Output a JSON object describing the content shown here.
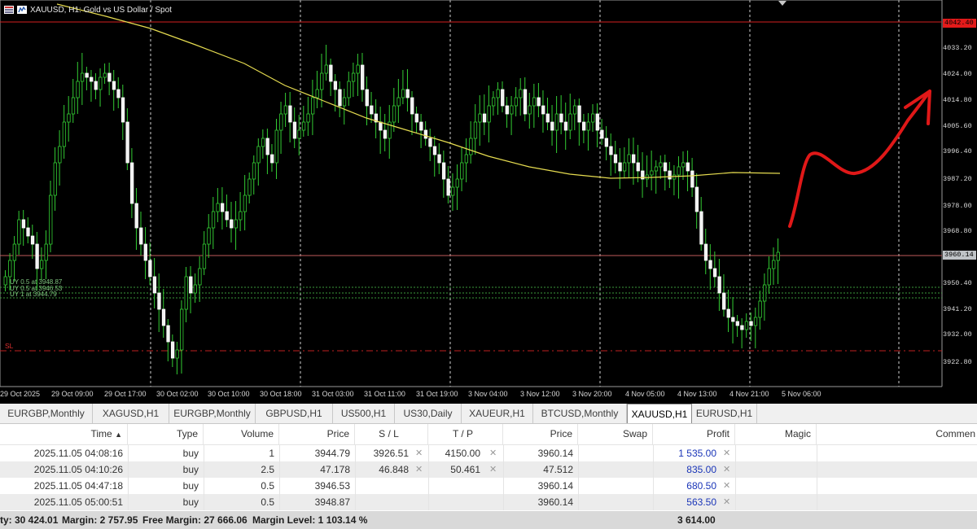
{
  "chart": {
    "title": "XAUUSD, H1:  Gold vs US Dollar / Spot",
    "price_scale": [
      "4033.20",
      "4024.00",
      "4014.80",
      "4005.60",
      "3996.40",
      "3987.20",
      "3978.00",
      "3968.80",
      "3950.40",
      "3941.20",
      "3932.00",
      "3922.80"
    ],
    "tags": {
      "top_red": "4042.40",
      "current_price": "3960.14"
    },
    "time_labels": [
      "29 Oct 2025",
      "29 Oct 09:00",
      "29 Oct 17:00",
      "30 Oct 02:00",
      "30 Oct 10:00",
      "30 Oct 18:00",
      "31 Oct 03:00",
      "31 Oct 11:00",
      "31 Oct 19:00",
      "3 Nov 04:00",
      "3 Nov 12:00",
      "3 Nov 20:00",
      "4 Nov 05:00",
      "4 Nov 13:00",
      "4 Nov 21:00",
      "5 Nov 06:00"
    ],
    "order_lines": [
      "UY 0.5 at 3948.87",
      "UY 0.5 at 3946.53",
      "UY 1 at 3944.79"
    ],
    "sl_label": "SL",
    "colors": {
      "candle": "#33cc33",
      "ma": "#e6dc50",
      "annotation": "#e01818",
      "price_line": "#c05a5a"
    }
  },
  "tabs": [
    "EURGBP,Monthly",
    "XAGUSD,H1",
    "EURGBP,Monthly",
    "GBPUSD,H1",
    "US500,H1",
    "US30,Daily",
    "XAUEUR,H1",
    "BTCUSD,Monthly",
    "XAUUSD,H1",
    "EURUSD,H1"
  ],
  "active_tab": "XAUUSD,H1",
  "table": {
    "headers": {
      "time": "Time",
      "type": "Type",
      "volume": "Volume",
      "price": "Price",
      "sl": "S / L",
      "tp": "T / P",
      "price2": "Price",
      "swap": "Swap",
      "profit": "Profit",
      "magic": "Magic",
      "comment": "Commen"
    },
    "sort_arrow": "▲",
    "rows": [
      {
        "time": "2025.11.05 04:08:16",
        "type": "buy",
        "volume": "1",
        "price": "3944.79",
        "sl": "3926.51",
        "tp": "4150.00",
        "price2": "3960.14",
        "swap": "",
        "profit": "1 535.00"
      },
      {
        "time": "2025.11.05 04:10:26",
        "type": "buy",
        "volume": "2.5",
        "price": "47.178",
        "sl": "46.848",
        "tp": "50.461",
        "price2": "47.512",
        "swap": "",
        "profit": "835.00"
      },
      {
        "time": "2025.11.05 04:47:18",
        "type": "buy",
        "volume": "0.5",
        "price": "3946.53",
        "sl": "",
        "tp": "",
        "price2": "3960.14",
        "swap": "",
        "profit": "680.50"
      },
      {
        "time": "2025.11.05 05:00:51",
        "type": "buy",
        "volume": "0.5",
        "price": "3948.87",
        "sl": "",
        "tp": "",
        "price2": "3960.14",
        "swap": "",
        "profit": "563.50"
      }
    ]
  },
  "status": {
    "equity": "ty: 30 424.01",
    "margin": "Margin: 2 757.95",
    "free_margin": "Free Margin: 27 666.06",
    "margin_level": "Margin Level: 1 103.14 %",
    "total_profit": "3 614.00"
  }
}
